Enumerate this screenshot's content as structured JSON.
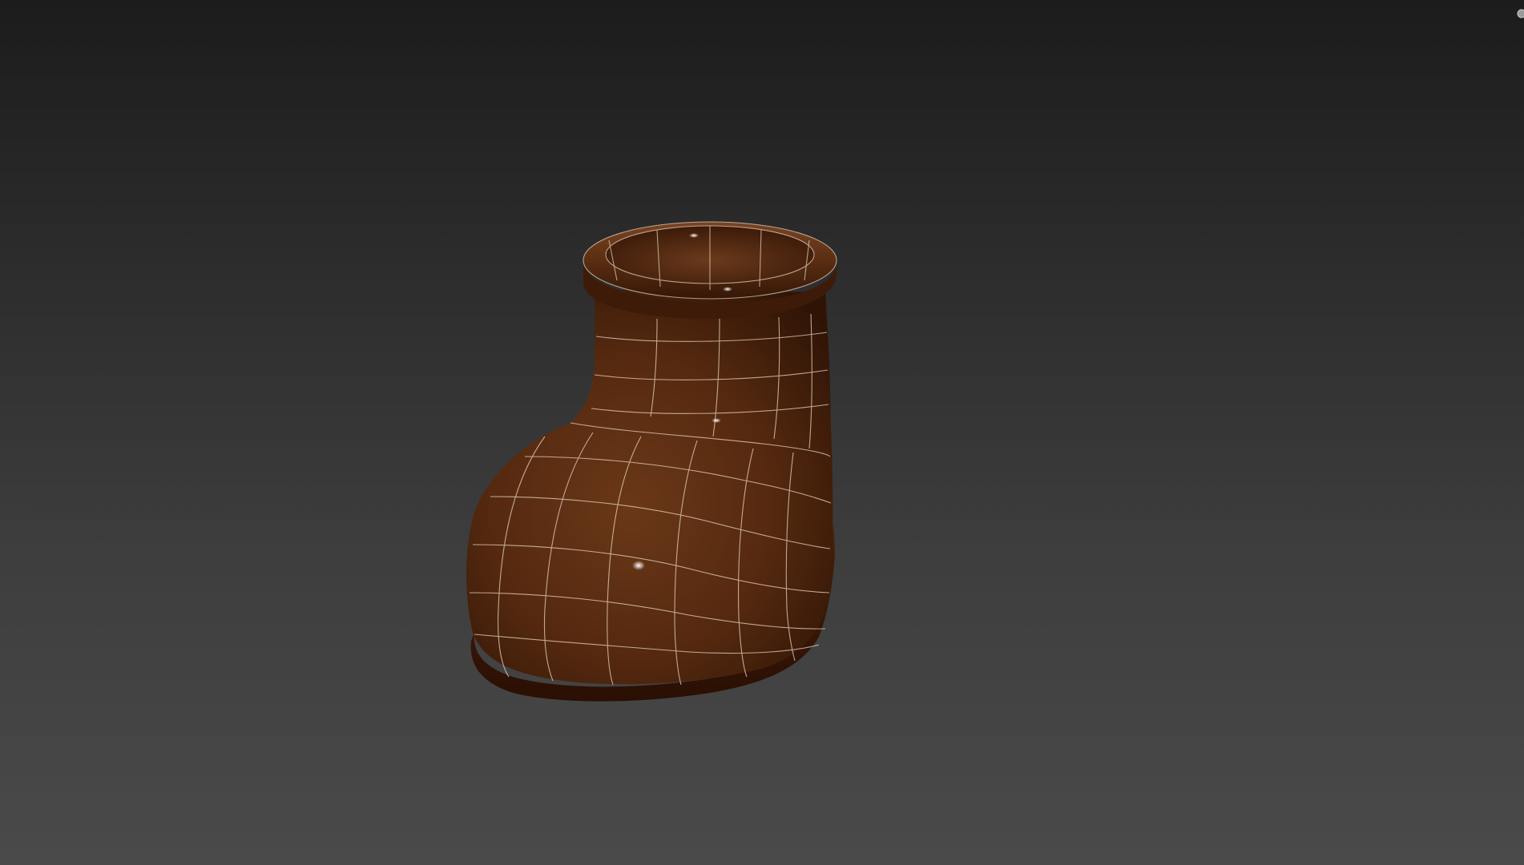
{
  "viewport": {
    "background_top": "#1c1c1c",
    "background_bottom": "#4a4a4a"
  },
  "model": {
    "object": "boot",
    "shading": "smooth-with-wireframe",
    "base_color": "#5a2f14",
    "highlight_color": "#8a4f2a",
    "shadow_color": "#2a1206",
    "wire_color": "#e8d8c8"
  },
  "icons": {
    "corner": "viewcube-icon"
  }
}
